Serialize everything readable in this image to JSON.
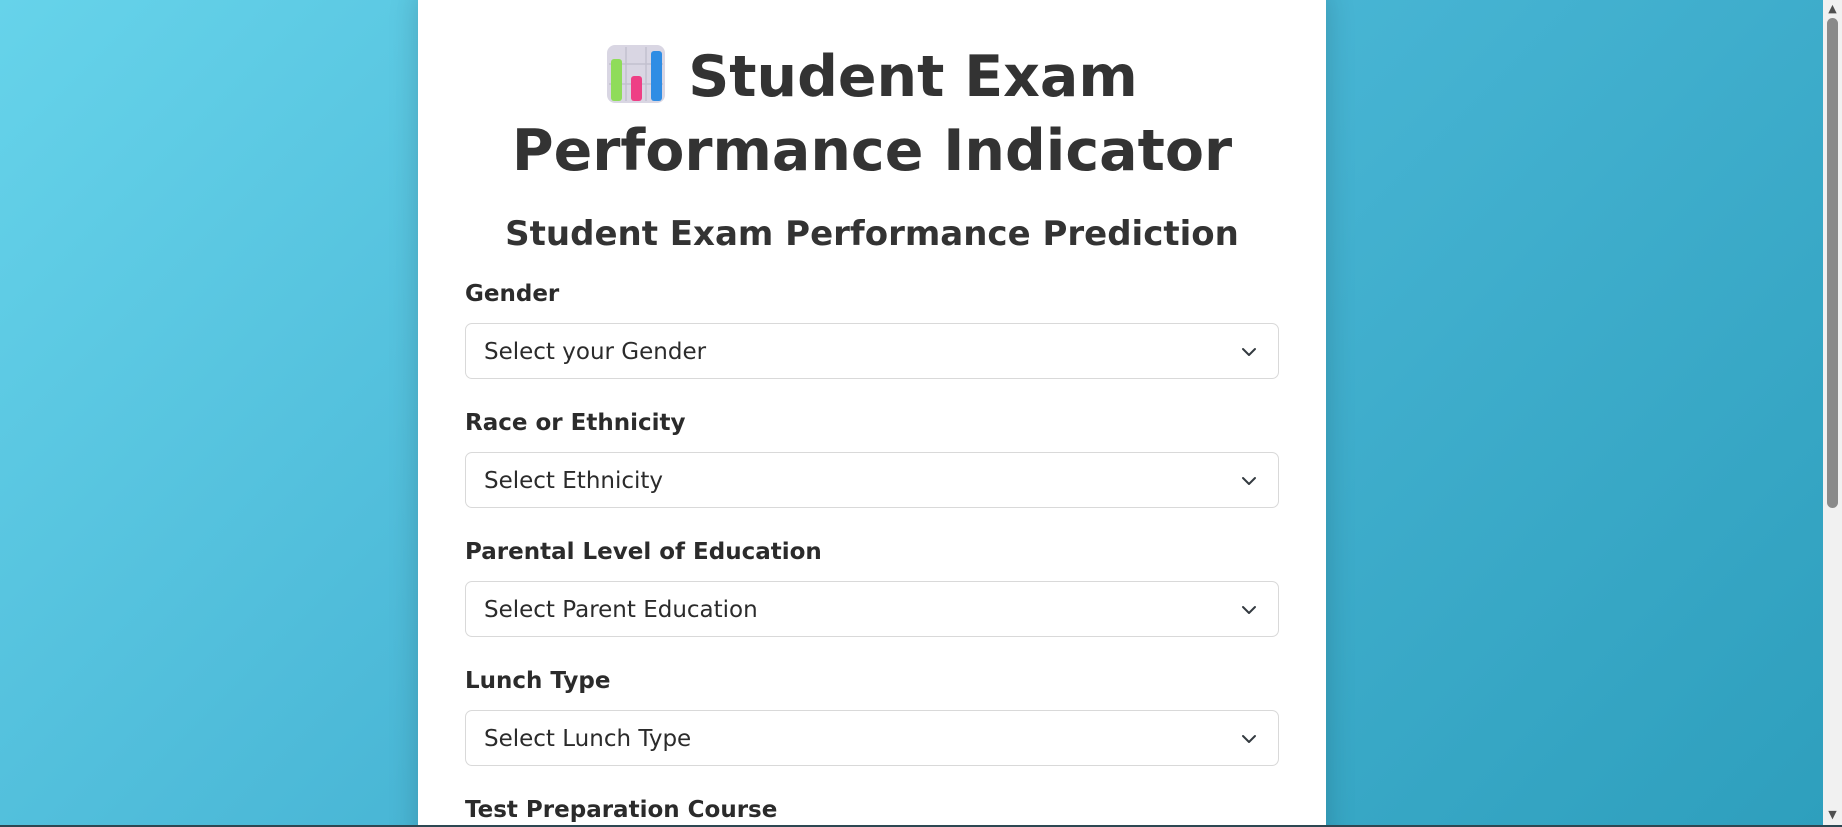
{
  "page": {
    "title_line1": "Student Exam",
    "title_line2": "Performance Indicator",
    "title_icon": "bar-chart-icon",
    "subtitle": "Student Exam Performance Prediction"
  },
  "form": {
    "fields": [
      {
        "label": "Gender",
        "selected": "Select your Gender"
      },
      {
        "label": "Race or Ethnicity",
        "selected": "Select Ethnicity"
      },
      {
        "label": "Parental Level of Education",
        "selected": "Select Parent Education"
      },
      {
        "label": "Lunch Type",
        "selected": "Select Lunch Type"
      },
      {
        "label": "Test Preparation Course"
      }
    ]
  },
  "colors": {
    "background_start": "#66d3ea",
    "background_end": "#2e9fbd",
    "card": "#ffffff",
    "text": "#333333"
  }
}
